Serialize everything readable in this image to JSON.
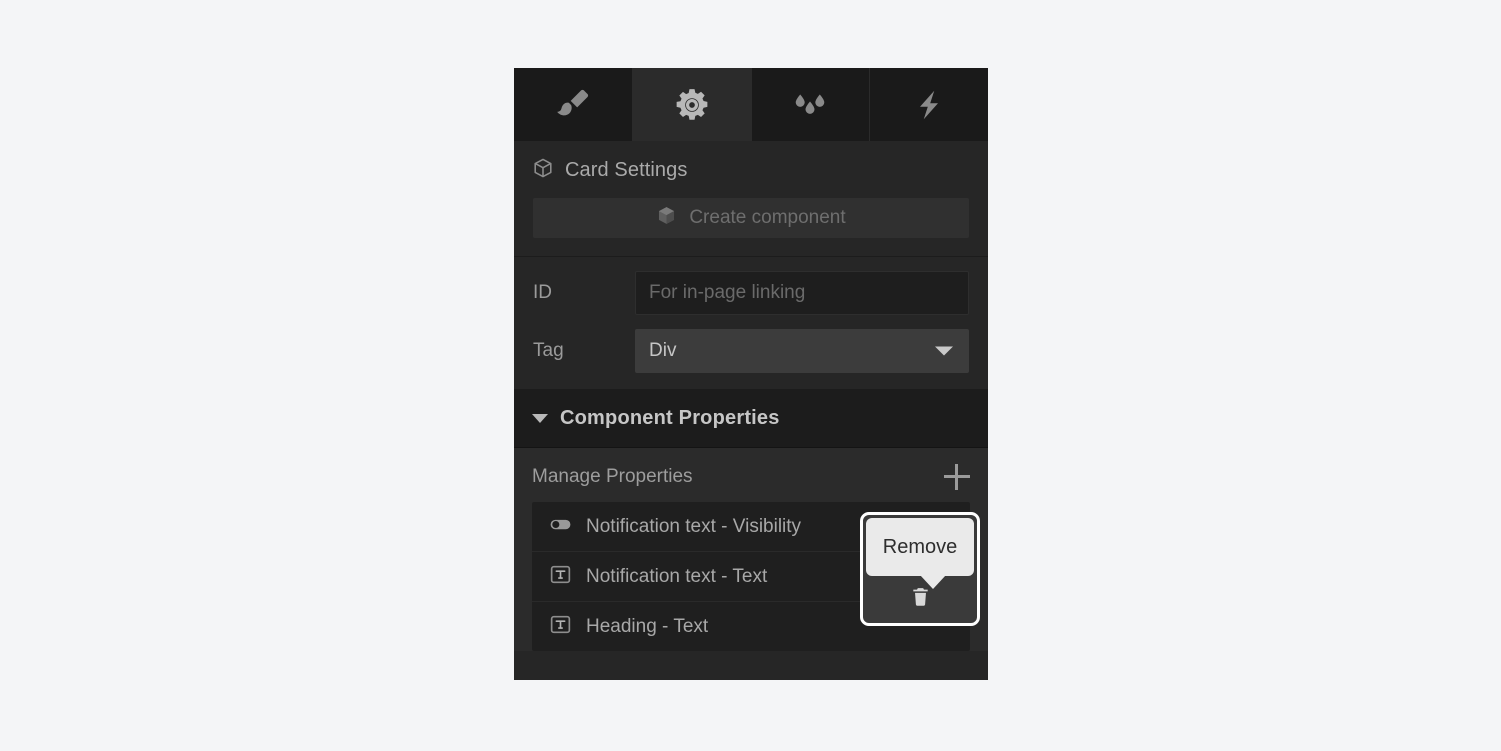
{
  "page": {
    "background_color": "#f4f5f7",
    "panel_background": "#262626"
  },
  "tabs": [
    {
      "name": "style",
      "icon": "paint-brush-icon",
      "active": false
    },
    {
      "name": "settings",
      "icon": "gear-icon",
      "active": true
    },
    {
      "name": "effects",
      "icon": "water-drops-icon",
      "active": false
    },
    {
      "name": "interactions",
      "icon": "lightning-bolt-icon",
      "active": false
    }
  ],
  "card_settings": {
    "icon": "cube-outline-icon",
    "title": "Card Settings",
    "create_component_button": {
      "label": "Create component",
      "icon": "cube-filled-icon",
      "disabled": true
    }
  },
  "fields": {
    "id": {
      "label": "ID",
      "value": "",
      "placeholder": "For in-page linking"
    },
    "tag": {
      "label": "Tag",
      "value": "Div",
      "options": [
        "Div"
      ],
      "caret_icon": "chevron-down-icon"
    }
  },
  "component_properties": {
    "title": "Component Properties",
    "expanded": true,
    "caret_icon": "triangle-down-icon",
    "manage": {
      "label": "Manage Properties",
      "add_icon": "plus-icon"
    },
    "items": [
      {
        "label": "Notification text - Visibility",
        "icon": "toggle-switch-icon"
      },
      {
        "label": "Notification text - Text",
        "icon": "text-field-icon"
      },
      {
        "label": "Heading - Text",
        "icon": "text-field-icon"
      }
    ]
  },
  "overlay": {
    "tooltip": {
      "text": "Remove",
      "background_color": "#eaeaea",
      "text_color": "#2e2e2e"
    },
    "highlight": {
      "border_color": "#ffffff"
    },
    "action_icon": "trash-icon"
  }
}
